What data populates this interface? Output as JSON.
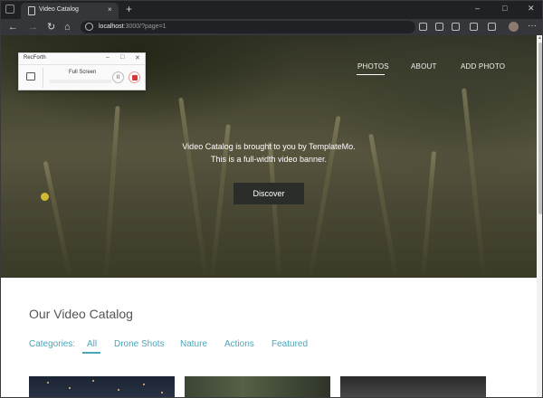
{
  "browser": {
    "tab_title": "Video Catalog",
    "tab_close": "×",
    "new_tab": "+",
    "window_controls": {
      "minimize": "–",
      "maximize": "□",
      "close": "✕"
    },
    "nav": {
      "back": "←",
      "forward": "→",
      "reload": "↻",
      "home": "⌂"
    },
    "address": {
      "host": "localhost",
      "rest": ":3000/?page=1"
    },
    "more": "···"
  },
  "site": {
    "nav": [
      "PHOTOS",
      "ABOUT",
      "ADD PHOTO"
    ],
    "active_nav": "PHOTOS",
    "hero_lines": [
      "Video Catalog is brought to you by TemplateMo.",
      "This is a full-width video banner."
    ],
    "discover_button": "Discover",
    "section_title": "Our Video Catalog",
    "categories_label": "Categories:",
    "categories": [
      "All",
      "Drone Shots",
      "Nature",
      "Actions",
      "Featured"
    ],
    "active_category": "All"
  },
  "recorder": {
    "title": "RecForth",
    "minimize": "–",
    "maximize": "□",
    "close": "✕",
    "mode": "Full Screen",
    "pause": "II"
  }
}
